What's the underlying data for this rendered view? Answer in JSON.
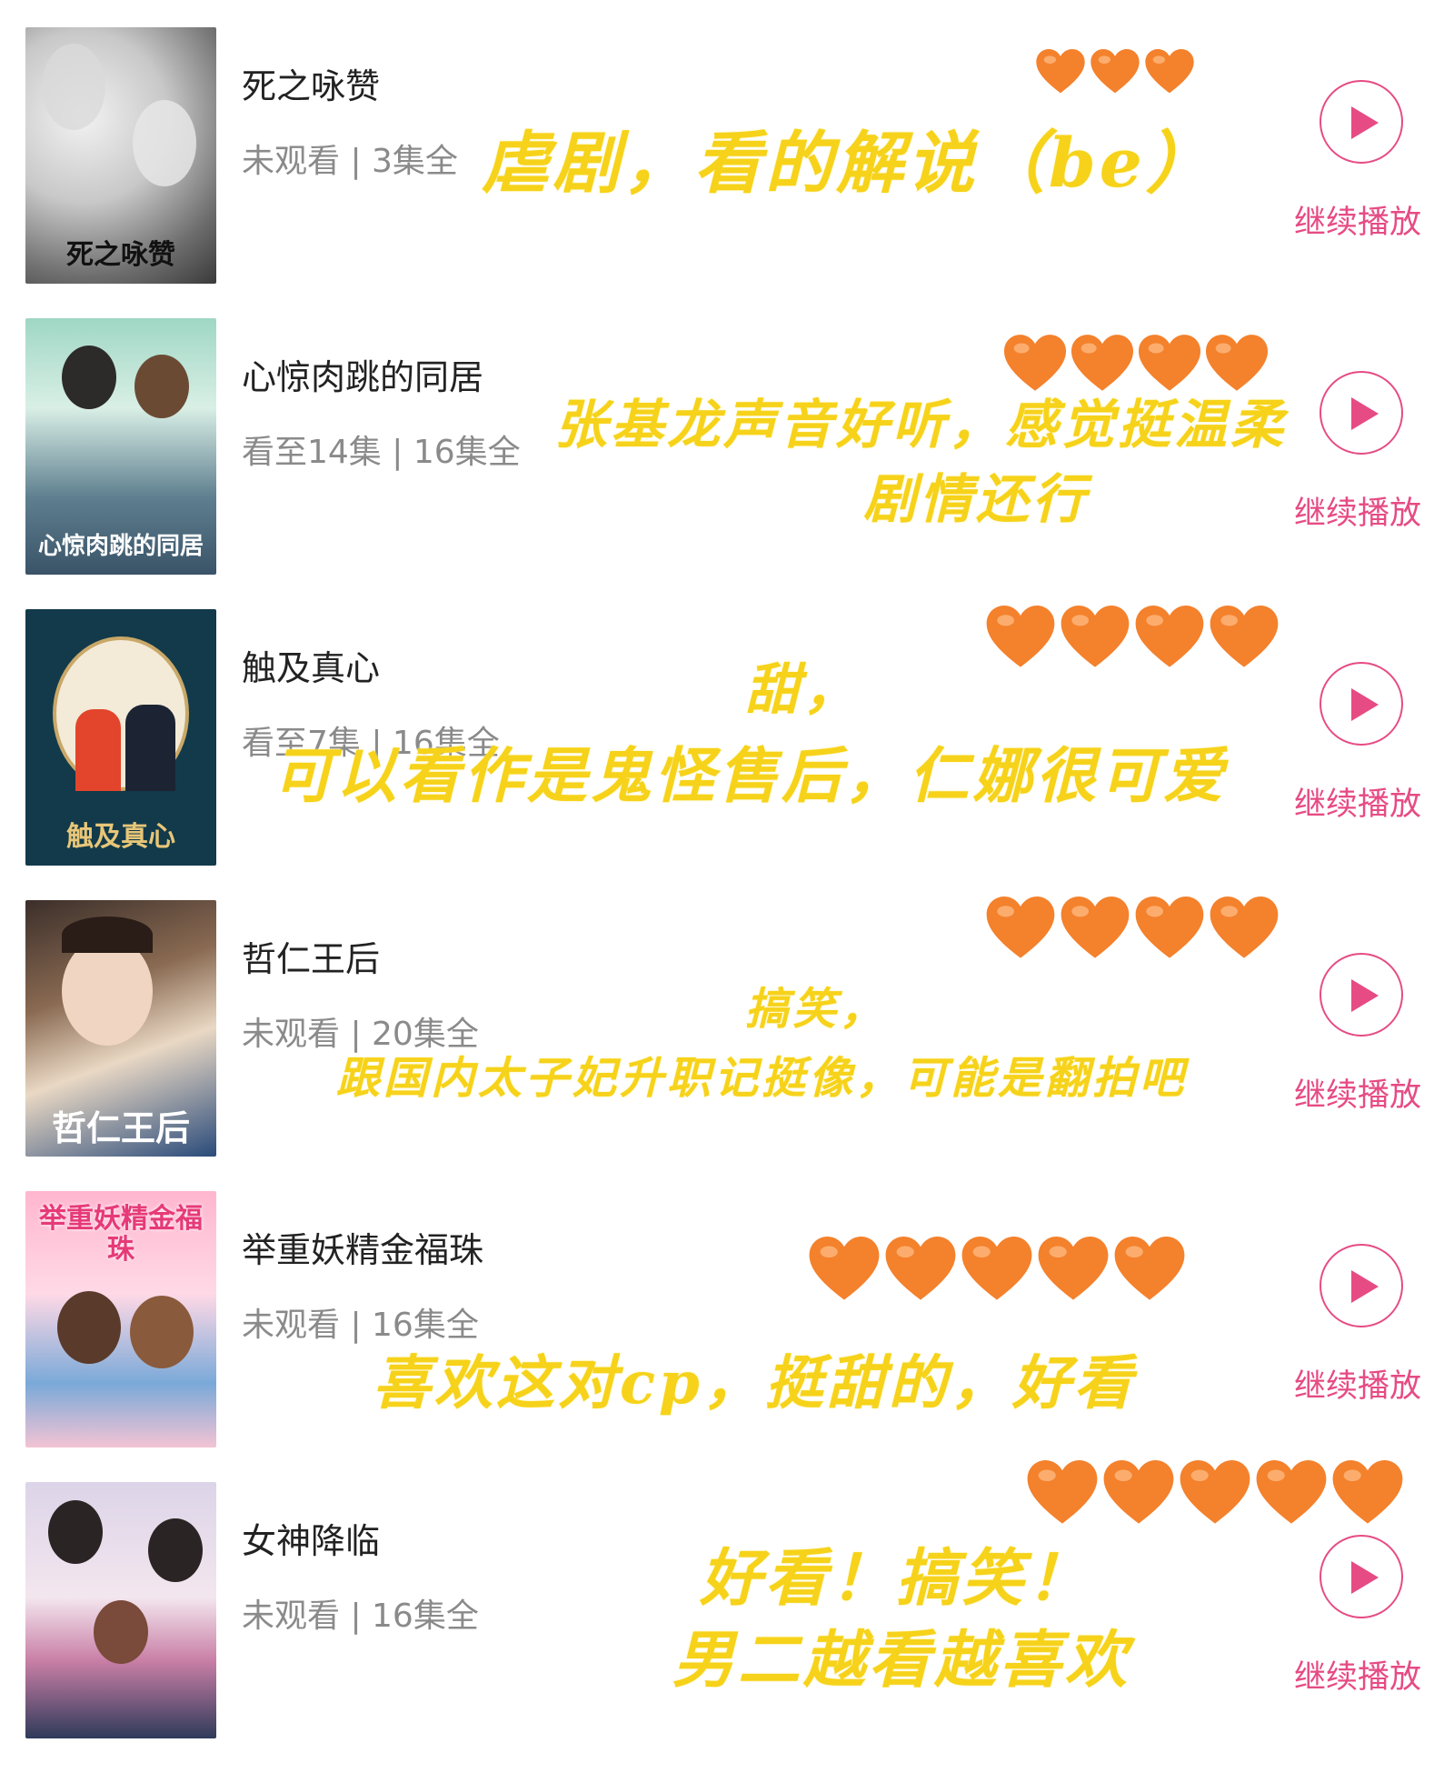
{
  "colors": {
    "accent": "#e64b84",
    "note": "#f6d21a",
    "heart": "#f4812c"
  },
  "items": [
    {
      "title": "死之咏赞",
      "meta": "未观看 | 3集全",
      "poster_title": "死之咏赞",
      "continue_label": "继续播放",
      "hearts": 3,
      "note_lines": [
        "虐剧，看的解说（be）"
      ]
    },
    {
      "title": "心惊肉跳的同居",
      "meta": "看至14集 | 16集全",
      "poster_title": "心惊肉跳的同居",
      "continue_label": "继续播放",
      "hearts": 4,
      "note_lines": [
        "张基龙声音好听，感觉挺温柔",
        "剧情还行"
      ]
    },
    {
      "title": "触及真心",
      "meta": "看至7集 | 16集全",
      "poster_title": "触及真心",
      "continue_label": "继续播放",
      "hearts": 4,
      "note_lines": [
        "甜，",
        "可以看作是鬼怪售后，仁娜很可爱"
      ]
    },
    {
      "title": "哲仁王后",
      "meta": "未观看 | 20集全",
      "poster_title": "哲仁王后",
      "continue_label": "继续播放",
      "hearts": 4,
      "note_lines": [
        "搞笑，",
        "跟国内太子妃升职记挺像，可能是翻拍吧"
      ]
    },
    {
      "title": "举重妖精金福珠",
      "meta": "未观看 | 16集全",
      "poster_title": "举重妖精金福珠",
      "continue_label": "继续播放",
      "hearts": 5,
      "note_lines": [
        "喜欢这对cp，挺甜的，好看"
      ]
    },
    {
      "title": "女神降临",
      "meta": "未观看 | 16集全",
      "poster_title": "",
      "continue_label": "继续播放",
      "hearts": 5,
      "note_lines": [
        "好看！搞笑！",
        "男二越看越喜欢"
      ]
    }
  ]
}
